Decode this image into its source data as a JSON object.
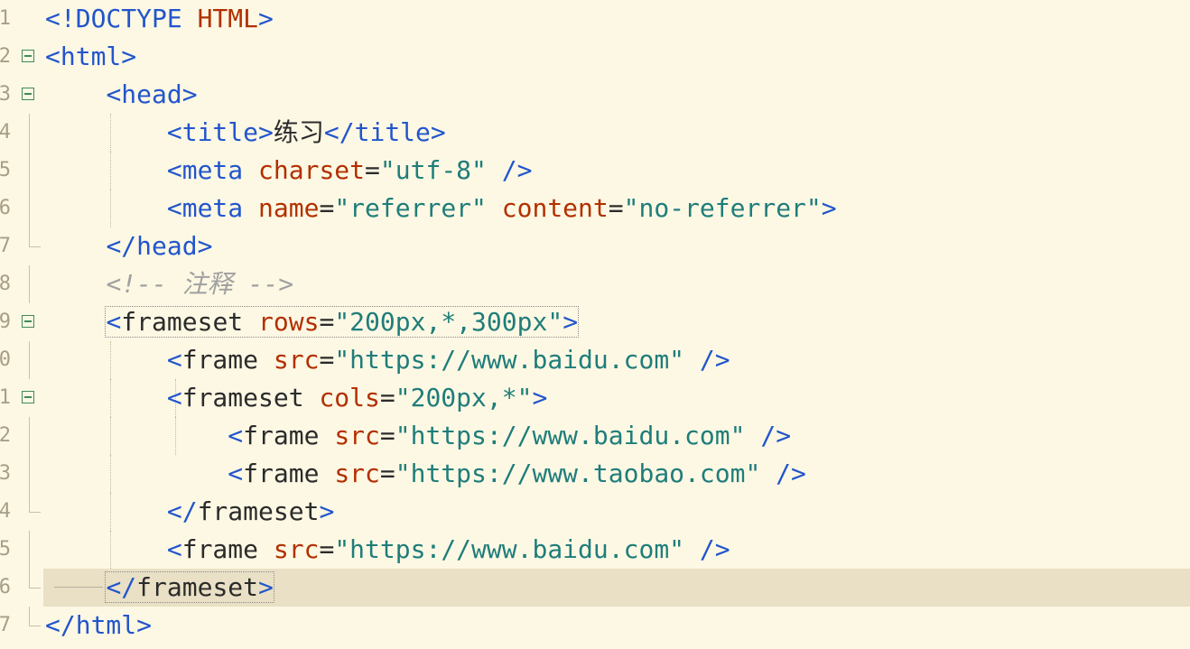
{
  "editor": {
    "lines": [
      {
        "n": "1",
        "parts": [
          {
            "c": "t",
            "v": "<!DOCTYPE "
          },
          {
            "c": "d",
            "v": "HTML"
          },
          {
            "c": "t",
            "v": ">"
          }
        ]
      },
      {
        "n": "2",
        "parts": [
          {
            "c": "t",
            "v": "<html>"
          }
        ]
      },
      {
        "n": "3",
        "parts": [
          {
            "c": "txt",
            "v": "    "
          },
          {
            "c": "t",
            "v": "<head>"
          }
        ]
      },
      {
        "n": "4",
        "parts": [
          {
            "c": "txt",
            "v": "        "
          },
          {
            "c": "t",
            "v": "<title>"
          },
          {
            "c": "txt",
            "v": "练习"
          },
          {
            "c": "t",
            "v": "</title>"
          }
        ]
      },
      {
        "n": "5",
        "parts": [
          {
            "c": "txt",
            "v": "        "
          },
          {
            "c": "t",
            "v": "<meta "
          },
          {
            "c": "a",
            "v": "charset"
          },
          {
            "c": "txt",
            "v": "="
          },
          {
            "c": "s",
            "v": "\"utf-8\""
          },
          {
            "c": "t",
            "v": " />"
          }
        ]
      },
      {
        "n": "6",
        "parts": [
          {
            "c": "txt",
            "v": "        "
          },
          {
            "c": "t",
            "v": "<meta "
          },
          {
            "c": "a",
            "v": "name"
          },
          {
            "c": "txt",
            "v": "="
          },
          {
            "c": "s",
            "v": "\"referrer\""
          },
          {
            "c": "txt",
            "v": " "
          },
          {
            "c": "a",
            "v": "content"
          },
          {
            "c": "txt",
            "v": "="
          },
          {
            "c": "s",
            "v": "\"no-referrer\""
          },
          {
            "c": "t",
            "v": ">"
          }
        ]
      },
      {
        "n": "7",
        "parts": [
          {
            "c": "txt",
            "v": "    "
          },
          {
            "c": "t",
            "v": "</head>"
          }
        ]
      },
      {
        "n": "8",
        "parts": [
          {
            "c": "txt",
            "v": "    "
          },
          {
            "c": "c",
            "v": "<!-- 注释 -->"
          }
        ]
      },
      {
        "n": "9",
        "parts": [
          {
            "c": "txt",
            "v": "    "
          },
          {
            "c": "t",
            "v": "<",
            "box": "start"
          },
          {
            "c": "txt",
            "v": "frameset "
          },
          {
            "c": "a",
            "v": "rows"
          },
          {
            "c": "txt",
            "v": "="
          },
          {
            "c": "s",
            "v": "\"200px,*,300px\""
          },
          {
            "c": "t",
            "v": ">",
            "box": "end"
          }
        ]
      },
      {
        "n": "0",
        "parts": [
          {
            "c": "txt",
            "v": "        "
          },
          {
            "c": "t",
            "v": "<"
          },
          {
            "c": "txt",
            "v": "frame "
          },
          {
            "c": "a",
            "v": "src"
          },
          {
            "c": "txt",
            "v": "="
          },
          {
            "c": "s",
            "v": "\"https://www.baidu.com\""
          },
          {
            "c": "t",
            "v": " />"
          }
        ]
      },
      {
        "n": "1",
        "parts": [
          {
            "c": "txt",
            "v": "        "
          },
          {
            "c": "t",
            "v": "<"
          },
          {
            "c": "txt",
            "v": "frameset "
          },
          {
            "c": "a",
            "v": "cols"
          },
          {
            "c": "txt",
            "v": "="
          },
          {
            "c": "s",
            "v": "\"200px,*\""
          },
          {
            "c": "t",
            "v": ">"
          }
        ]
      },
      {
        "n": "2",
        "parts": [
          {
            "c": "txt",
            "v": "            "
          },
          {
            "c": "t",
            "v": "<"
          },
          {
            "c": "txt",
            "v": "frame "
          },
          {
            "c": "a",
            "v": "src"
          },
          {
            "c": "txt",
            "v": "="
          },
          {
            "c": "s",
            "v": "\"https://www.baidu.com\""
          },
          {
            "c": "t",
            "v": " />"
          }
        ]
      },
      {
        "n": "3",
        "parts": [
          {
            "c": "txt",
            "v": "            "
          },
          {
            "c": "t",
            "v": "<"
          },
          {
            "c": "txt",
            "v": "frame "
          },
          {
            "c": "a",
            "v": "src"
          },
          {
            "c": "txt",
            "v": "="
          },
          {
            "c": "s",
            "v": "\"https://www.taobao.com\""
          },
          {
            "c": "t",
            "v": " />"
          }
        ]
      },
      {
        "n": "4",
        "parts": [
          {
            "c": "txt",
            "v": "        "
          },
          {
            "c": "t",
            "v": "</"
          },
          {
            "c": "txt",
            "v": "frameset"
          },
          {
            "c": "t",
            "v": ">"
          }
        ]
      },
      {
        "n": "5",
        "parts": [
          {
            "c": "txt",
            "v": "        "
          },
          {
            "c": "t",
            "v": "<"
          },
          {
            "c": "txt",
            "v": "frame "
          },
          {
            "c": "a",
            "v": "src"
          },
          {
            "c": "txt",
            "v": "="
          },
          {
            "c": "s",
            "v": "\"https://www.baidu.com\""
          },
          {
            "c": "t",
            "v": " />"
          }
        ]
      },
      {
        "n": "6",
        "parts": [
          {
            "c": "txt",
            "v": "    "
          },
          {
            "c": "t",
            "v": "</",
            "box": "start"
          },
          {
            "c": "txt",
            "v": "frameset"
          },
          {
            "c": "t",
            "v": ">",
            "box": "end"
          }
        ]
      },
      {
        "n": "7",
        "parts": [
          {
            "c": "t",
            "v": "</html>"
          }
        ]
      }
    ],
    "colors": {
      "background": "#fdf8e4",
      "current_line": "#e9e0c5",
      "tag": "#2255cc",
      "attribute": "#b23000",
      "string": "#1f7d7a",
      "comment": "#a0a0a0",
      "fold_marker": "#3f8a5a"
    },
    "icons": [
      "fold-collapse-icon",
      "fold-end-icon"
    ]
  }
}
